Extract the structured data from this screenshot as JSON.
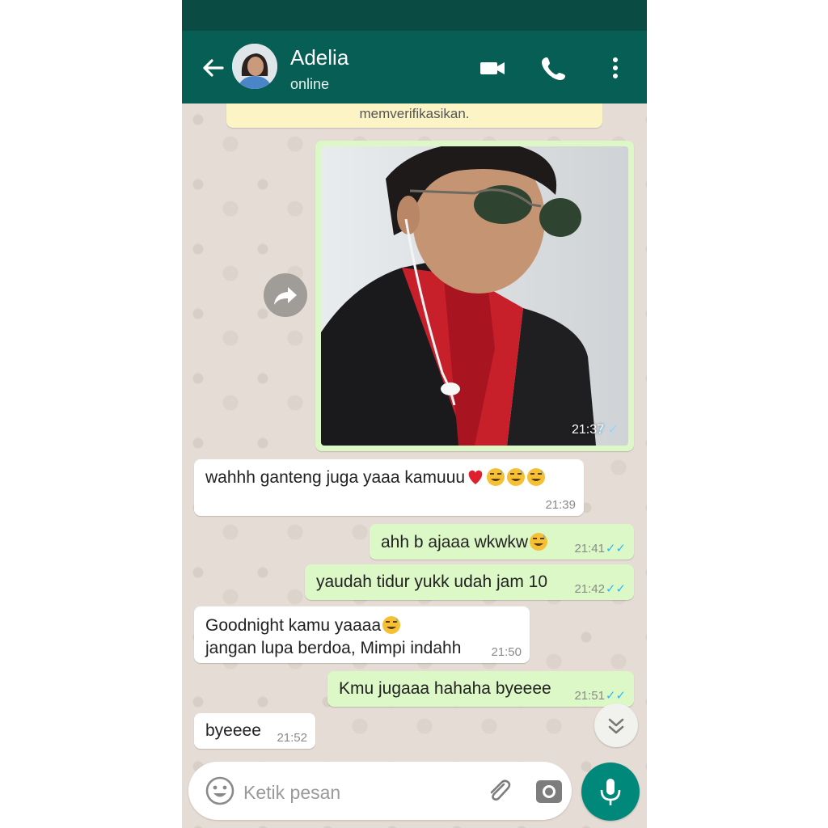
{
  "header": {
    "contact_name": "Adelia",
    "contact_status": "online"
  },
  "notice": {
    "text": "memverifikasikan."
  },
  "messages": [
    {
      "direction": "out",
      "type": "image",
      "time": "21:37",
      "status": "read"
    },
    {
      "direction": "in",
      "text": "wahhh ganteng juga yaaa kamuuu",
      "time": "21:39",
      "emoji": [
        "red-heart",
        "sweat-smile",
        "sweat-smile",
        "sweat-smile"
      ]
    },
    {
      "direction": "out",
      "text": "ahh b ajaaa wkwkw",
      "time": "21:41",
      "status": "read",
      "emoji": [
        "sweat-smile"
      ]
    },
    {
      "direction": "out",
      "text": "yaudah tidur yukk udah jam 10",
      "time": "21:42",
      "status": "read"
    },
    {
      "direction": "in",
      "lines": [
        "Goodnight kamu yaaaa",
        "jangan lupa berdoa, Mimpi indahh"
      ],
      "time": "21:50",
      "emoji": [
        "sweat-smile"
      ]
    },
    {
      "direction": "out",
      "text": "Kmu jugaaa hahaha byeeee",
      "time": "21:51",
      "status": "read"
    },
    {
      "direction": "in",
      "text": "byeeee",
      "time": "21:52"
    }
  ],
  "composer": {
    "placeholder": "Ketik pesan"
  },
  "colors": {
    "header": "#075e54",
    "statusbar": "#0a4b43",
    "outgoing_bubble": "#dcf8c6",
    "incoming_bubble": "#ffffff",
    "read_ticks": "#34b7f1",
    "mic_button": "#00897b"
  },
  "icons": [
    "back-arrow-icon",
    "video-call-icon",
    "phone-icon",
    "more-vert-icon",
    "forward-icon",
    "scroll-down-icon",
    "emoji-icon",
    "attach-icon",
    "camera-icon",
    "mic-icon"
  ]
}
